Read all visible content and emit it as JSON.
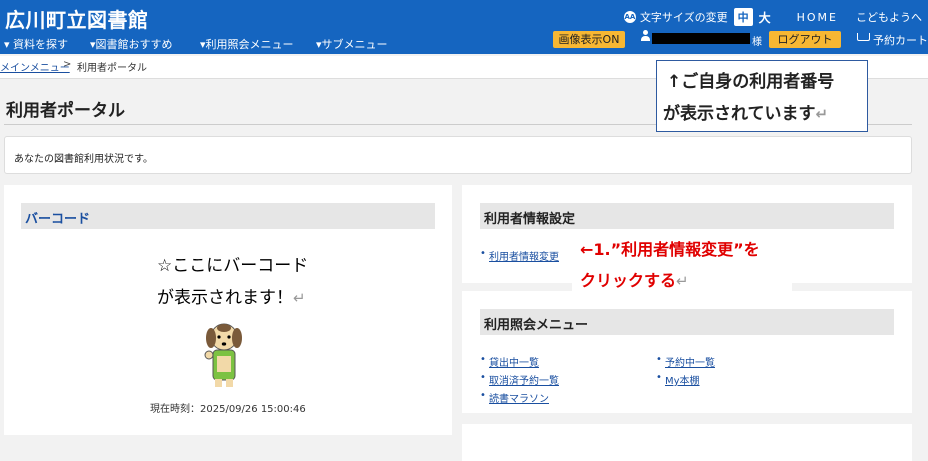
{
  "header": {
    "site_title": "広川町立図書館",
    "font_size_label": "文字サイズの変更",
    "font_size_mid": "中",
    "font_size_large": "大",
    "home": "HOME",
    "kids": "こどもようへ"
  },
  "nav": {
    "items": [
      "資料を探す",
      "図書館おすすめ",
      "利用照会メニュー",
      "サブメニュー"
    ],
    "image_toggle": "画像表示ON",
    "user_suffix": "様",
    "logout": "ログアウト",
    "cart": "予約カート"
  },
  "breadcrumb": {
    "parent": "メインメニュー",
    "separator": ">",
    "current": "利用者ポータル"
  },
  "page": {
    "title": "利用者ポータル",
    "intro": "あなたの図書館利用状況です。"
  },
  "barcode": {
    "heading": "バーコード",
    "note_line1": "☆ここにバーコード",
    "note_line2": "が表示されます！",
    "clock": "現在時刻：2025/09/26 15:00:46"
  },
  "settings": {
    "heading": "利用者情報設定",
    "link": "利用者情報変更"
  },
  "inquiry": {
    "heading": "利用照会メニュー",
    "links_left": [
      "貸出中一覧",
      "取消済予約一覧",
      "読書マラソン"
    ],
    "links_right": [
      "予約中一覧",
      "My本棚"
    ]
  },
  "annotations": {
    "callout_line1": "↑ご自身の利用者番号",
    "callout_line2": "が表示されています",
    "click_line1": "←1.”利用者情報変更”を",
    "click_line2": "クリックする",
    "return_mark": "↵"
  },
  "colors": {
    "header_bg": "#1565c0",
    "button_yellow": "#f7b733",
    "annotation_red": "#e00000"
  }
}
